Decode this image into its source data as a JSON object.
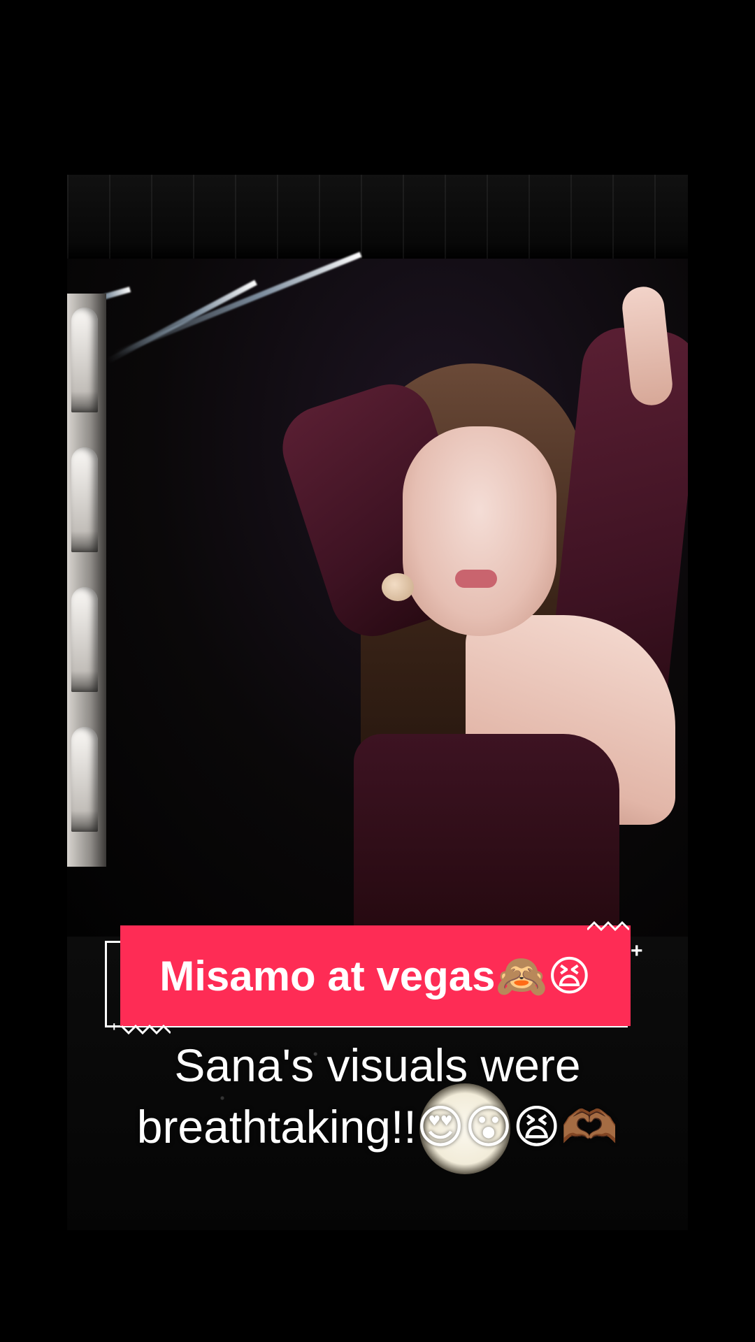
{
  "video": {
    "scene": "concert-stage-closeup"
  },
  "title_banner": {
    "text": "Misamo at vegas🙈😫",
    "background_color": "#fe2c55",
    "text_color": "#ffffff"
  },
  "caption": {
    "line_1": "Sana's visuals were",
    "line_2": "breathtaking!!😍😮😫🫶🏾"
  },
  "icons": {
    "plus_mark": "+"
  },
  "colors": {
    "background": "#000000",
    "accent": "#fe2c55",
    "sleeve": "#4a1a2b"
  }
}
